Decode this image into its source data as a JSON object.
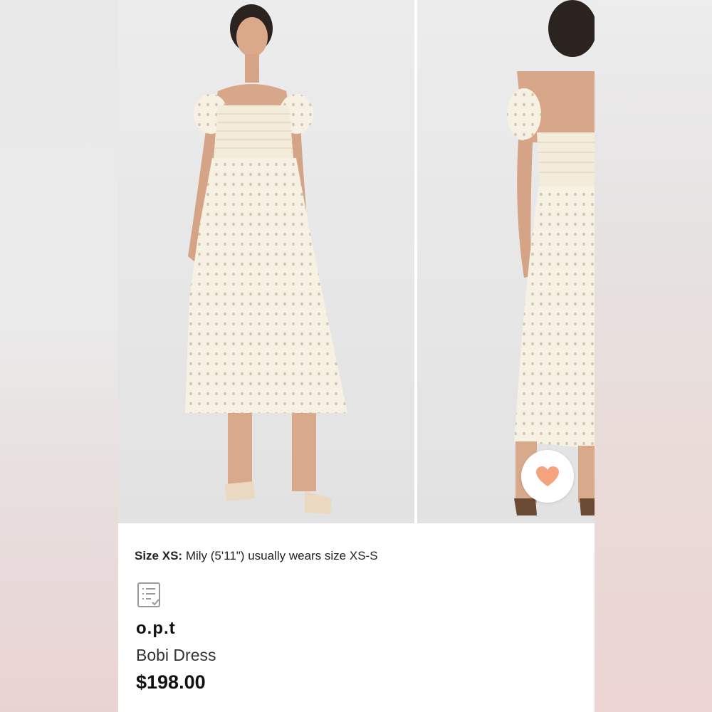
{
  "product": {
    "brand": "o.p.t",
    "name": "Bobi Dress",
    "price": "$198.00"
  },
  "size_info": {
    "label": "Size XS:",
    "text": "Mily (5'11\") usually wears size XS-S"
  },
  "icons": {
    "favorite": "heart-icon",
    "details": "list-check-icon"
  },
  "colors": {
    "heart": "#f4a37f",
    "dress": "#f5f0e1",
    "background": "#e7e7e7"
  }
}
